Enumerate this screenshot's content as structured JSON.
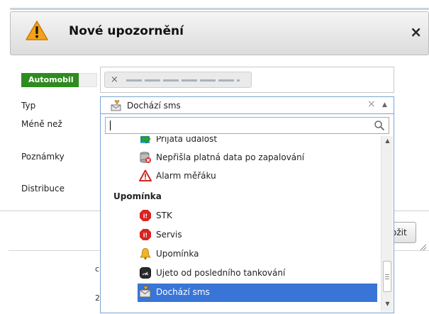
{
  "dialog": {
    "title": "Nové upozornění",
    "close_label": "×",
    "icon": "warning-icon"
  },
  "form": {
    "automobil": {
      "tab_label": "Automobil",
      "chip_remove": "×"
    },
    "typ": {
      "label": "Typ",
      "value": "Dochází sms",
      "clear": "×",
      "arrow": "▲"
    },
    "mene_nez": {
      "label": "Méně než"
    },
    "poznamky": {
      "label": "Poznámky"
    },
    "distribuce": {
      "label": "Distribuce"
    }
  },
  "dropdown": {
    "search_value": "",
    "items": [
      {
        "label": "Přijata událost",
        "icon": "event-arrow-icon"
      },
      {
        "label": "Nepřišla platná data po zapalování",
        "icon": "database-error-icon"
      },
      {
        "label": "Alarm měřáku",
        "icon": "alarm-triangle-icon"
      }
    ],
    "group": {
      "label": "Upomínka",
      "items": [
        {
          "label": "STK",
          "icon": "stk-icon"
        },
        {
          "label": "Servis",
          "icon": "servis-icon"
        },
        {
          "label": "Upomínka",
          "icon": "bell-icon"
        },
        {
          "label": "Ujeto od posledního tankování",
          "icon": "fuel-gauge-icon"
        },
        {
          "label": "Dochází sms",
          "icon": "sms-envelope-icon",
          "selected": true
        }
      ]
    }
  },
  "buttons": {
    "save_fragment": "ožit"
  },
  "background": {
    "frag_1": "c",
    "frag_2": "2"
  },
  "colors": {
    "accent_green": "#2e8b1f",
    "selection_blue": "#3875d7",
    "focus_border": "#7aa4d6"
  }
}
